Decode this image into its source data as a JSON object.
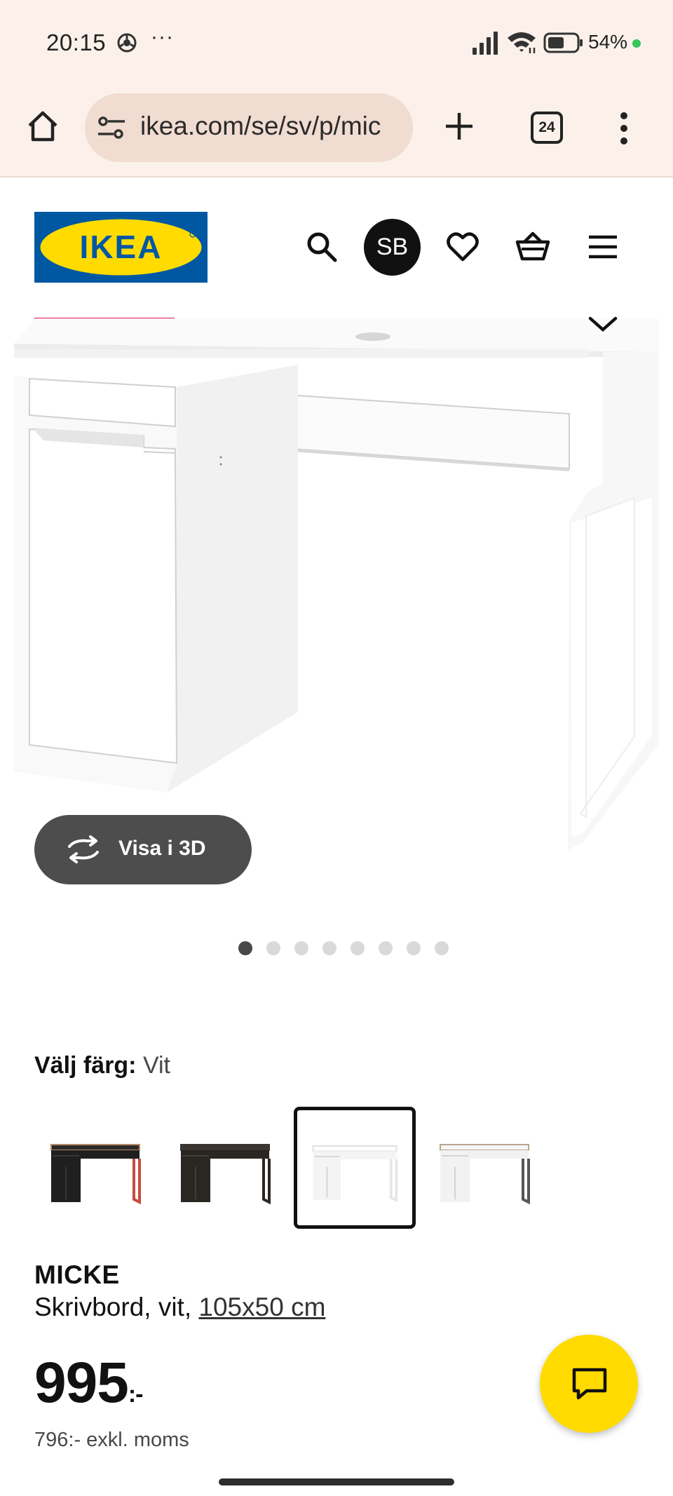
{
  "status_bar": {
    "time": "20:15",
    "dots": "···",
    "battery_text": "54%",
    "icons": [
      "chrome-icon",
      "signal-icon",
      "wifi-icon",
      "battery-icon"
    ]
  },
  "browser": {
    "url": "ikea.com/se/sv/p/mic",
    "tab_count": "24",
    "icons": [
      "home-icon",
      "tune-icon",
      "plus-icon",
      "more-vert-icon"
    ]
  },
  "header": {
    "logo_text": "IKEA",
    "avatar_initials": "SB",
    "icons": [
      "search-icon",
      "heart-icon",
      "cart-icon",
      "hamburger-menu-icon"
    ]
  },
  "gallery": {
    "view_3d_label": "Visa i 3D",
    "image_count": 8,
    "active_index": 0
  },
  "color_selector": {
    "label": "Välj färg:",
    "selected_value": "Vit",
    "options": [
      {
        "name": "black-red",
        "top": "#2b2b2b",
        "body": "#1f1f1f",
        "leg": "#c9493f",
        "edge": "#b88a6a"
      },
      {
        "name": "black-brown",
        "top": "#3a3530",
        "body": "#2a2622",
        "leg": "#2a2622",
        "edge": "#3a3530"
      },
      {
        "name": "white",
        "top": "#ffffff",
        "body": "#f4f4f4",
        "leg": "#e6e6e6",
        "edge": "#dddddd"
      },
      {
        "name": "white-anthracite",
        "top": "#f6f6f6",
        "body": "#f2f2f2",
        "leg": "#555555",
        "edge": "#b9a58f"
      }
    ],
    "selected_index": 2
  },
  "product": {
    "name": "MICKE",
    "desc_prefix": "Skrivbord, vit, ",
    "size": "105x50 cm",
    "price": "995",
    "price_suffix": ":-",
    "price_excl": "796:- exkl. moms"
  },
  "colors": {
    "ikea_blue": "#0058a3",
    "ikea_yellow": "#ffdb00",
    "accent_red": "#e0164c",
    "status_green": "#35c759"
  }
}
